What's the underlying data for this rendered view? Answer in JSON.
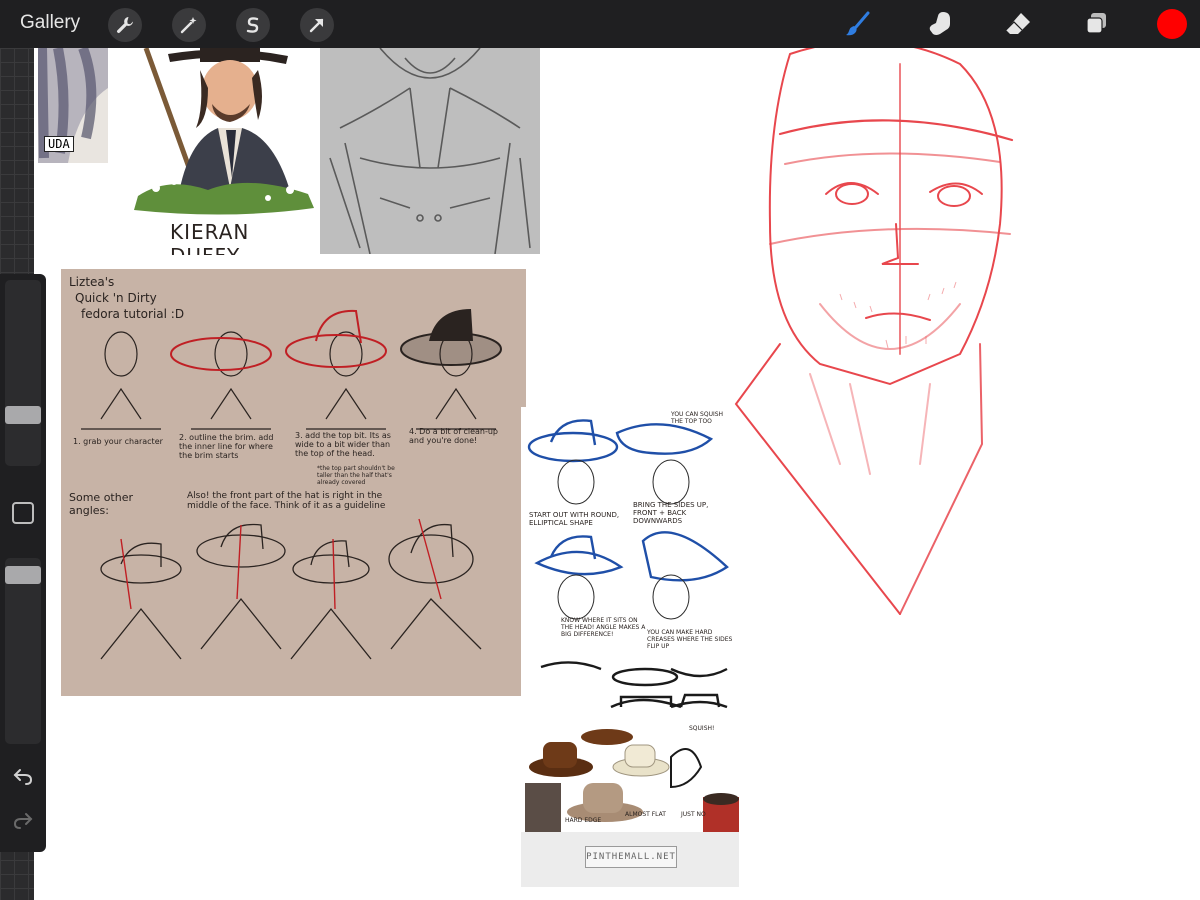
{
  "topbar": {
    "gallery_label": "Gallery",
    "left_tools": [
      {
        "name": "actions",
        "icon": "wrench-icon"
      },
      {
        "name": "adjustments",
        "icon": "magic-wand-icon"
      },
      {
        "name": "selection",
        "icon": "selection-s-icon"
      },
      {
        "name": "transform",
        "icon": "arrow-cursor-icon"
      }
    ],
    "right_tools": [
      {
        "name": "brush",
        "icon": "brush-icon",
        "active": true
      },
      {
        "name": "smudge",
        "icon": "smudge-finger-icon"
      },
      {
        "name": "eraser",
        "icon": "eraser-icon"
      },
      {
        "name": "layers",
        "icon": "layers-icon"
      }
    ],
    "current_color": "#ff0000"
  },
  "sidebar": {
    "brush_size_level": 0.25,
    "opacity_level": 0.95,
    "undo_icon": "undo-icon",
    "redo_icon": "redo-icon"
  },
  "references": {
    "character_art": {
      "signature": "KIERAN DUFFY",
      "stamp": "UDA"
    },
    "fedora_tutorial": {
      "title_lines": [
        "Liztea's",
        "Quick 'n Dirty",
        "fedora tutorial :D"
      ],
      "steps": [
        "1. grab your character",
        "2. outline the brim. add the inner line for where the brim starts",
        "3. add the top bit. Its as wide to a bit wider than the top of the head.",
        "4. Do a bit of clean-up and you're done!"
      ],
      "step_note": "*the top part shouldn't be taller than the half that's already covered",
      "other_angles": "Some other angles:",
      "also_note": "Also! the front part of the hat is right in the middle of the face. Think of it as a guideline"
    },
    "hat_guide": {
      "notes": [
        "YOU CAN SQUISH THE TOP TOO",
        "START OUT WITH ROUND, ELLIPTICAL SHAPE",
        "BRING THE SIDES UP, FRONT + BACK DOWNWARDS",
        "KNOW WHERE IT SITS ON THE HEAD! ANGLE MAKES A BIG DIFFERENCE!",
        "YOU CAN MAKE HARD CREASES WHERE THE SIDES FLIP UP",
        "SQUISH!",
        "HARD EDGE",
        "ALMOST FLAT",
        "JUST NO"
      ],
      "footer": "PINTHEMALL.NET"
    }
  },
  "colors": {
    "sketch": "#e8474d",
    "hat_blue": "#1f4fa8",
    "hat_red": "#c01f24"
  }
}
